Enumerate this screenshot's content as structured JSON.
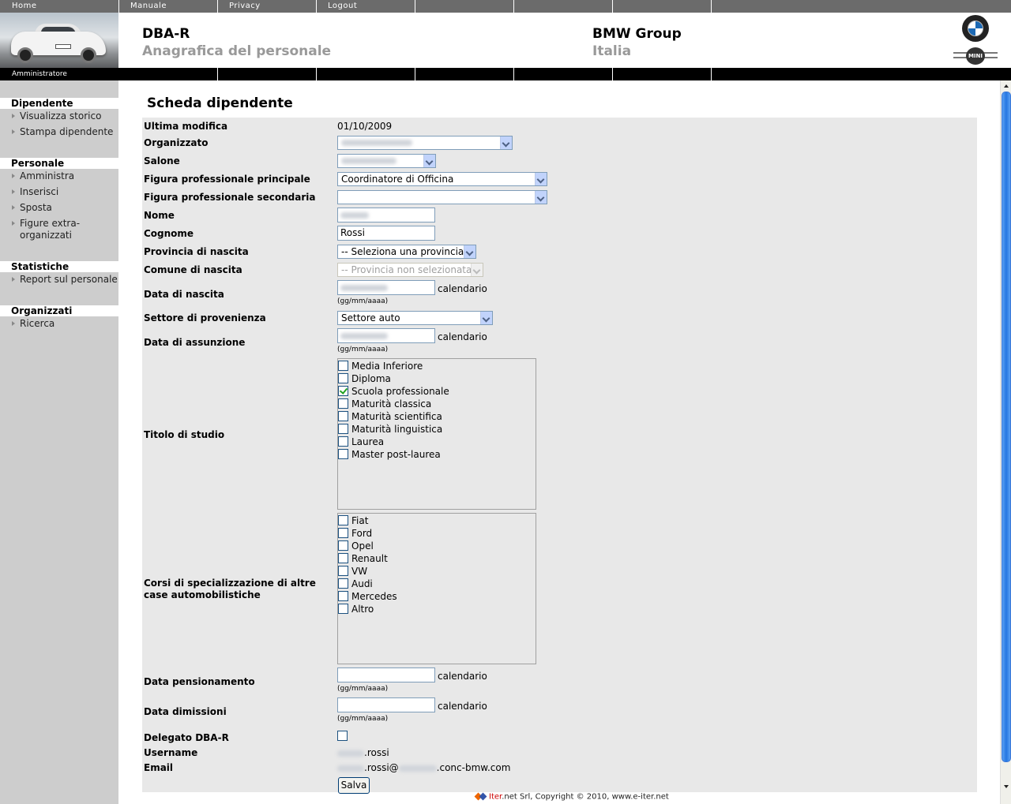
{
  "topnav": {
    "items": [
      "Home",
      "Manuale",
      "Privacy",
      "Logout",
      "",
      "",
      "",
      ""
    ]
  },
  "header": {
    "app_title": "DBA-R",
    "app_subtitle": "Anagrafica del personale",
    "company": "BMW Group",
    "country": "Italia",
    "role": "Amministratore"
  },
  "sidebar": {
    "groups": [
      {
        "heading": "Dipendente",
        "items": [
          "Visualizza storico",
          "Stampa dipendente"
        ]
      },
      {
        "heading": "Personale",
        "items": [
          "Amministra",
          "Inserisci",
          "Sposta",
          "Figure extra-\norganizzati"
        ]
      },
      {
        "heading": "Statistiche",
        "items": [
          "Report sul personale"
        ]
      },
      {
        "heading": "Organizzati",
        "items": [
          "Ricerca"
        ]
      }
    ]
  },
  "page": {
    "title": "Scheda dipendente"
  },
  "form": {
    "labels": {
      "ultima_modifica": "Ultima modifica",
      "organizzato": "Organizzato",
      "salone": "Salone",
      "fig_principale": "Figura professionale principale",
      "fig_secondaria": "Figura professionale secondaria",
      "nome": "Nome",
      "cognome": "Cognome",
      "provincia": "Provincia di nascita",
      "comune": "Comune di nascita",
      "data_nascita": "Data di nascita",
      "settore": "Settore di provenienza",
      "data_assunzione": "Data di assunzione",
      "titolo": "Titolo di studio",
      "corsi": "Corsi di specializzazione di altre case automobilistiche",
      "pensionamento": "Data pensionamento",
      "dimissioni": "Data dimissioni",
      "delegato": "Delegato DBA-R",
      "username": "Username",
      "email": "Email"
    },
    "values": {
      "ultima_modifica": "01/10/2009",
      "fig_principale": "Coordinatore di Officina",
      "fig_secondaria": "",
      "cognome": "Rossi",
      "provincia": "-- Seleziona una provincia --",
      "comune": "-- Provincia non selezionata --",
      "settore": "Settore auto",
      "data_pensionamento": "",
      "data_dimissioni": "",
      "username_suffix": ".rossi",
      "email_mid": ".rossi@",
      "email_suffix": ".conc-bmw.com"
    },
    "calendar_label": "calendario",
    "date_format": "(gg/mm/aaaa)",
    "titolo_options": [
      {
        "label": "Media Inferiore",
        "checked": false
      },
      {
        "label": "Diploma",
        "checked": false
      },
      {
        "label": "Scuola professionale",
        "checked": true
      },
      {
        "label": "Maturità classica",
        "checked": false
      },
      {
        "label": "Maturità scientifica",
        "checked": false
      },
      {
        "label": "Maturità linguistica",
        "checked": false
      },
      {
        "label": "Laurea",
        "checked": false
      },
      {
        "label": "Master post-laurea",
        "checked": false
      }
    ],
    "corsi_options": [
      {
        "label": "Fiat",
        "checked": false
      },
      {
        "label": "Ford",
        "checked": false
      },
      {
        "label": "Opel",
        "checked": false
      },
      {
        "label": "Renault",
        "checked": false
      },
      {
        "label": "VW",
        "checked": false
      },
      {
        "label": "Audi",
        "checked": false
      },
      {
        "label": "Mercedes",
        "checked": false
      },
      {
        "label": "Altro",
        "checked": false
      }
    ],
    "delegato_checked": false,
    "save_label": "Salva"
  },
  "footer": {
    "brand": "Iter",
    "text": ".net Srl, Copyright © 2010, www.e-iter.net"
  },
  "colors": {
    "topnav_bg": "#6b6b6b",
    "sidebar_bg": "#cdcdcd",
    "form_bg": "#e8e8e8",
    "subtitle": "#999999",
    "check_green": "#21a121"
  }
}
